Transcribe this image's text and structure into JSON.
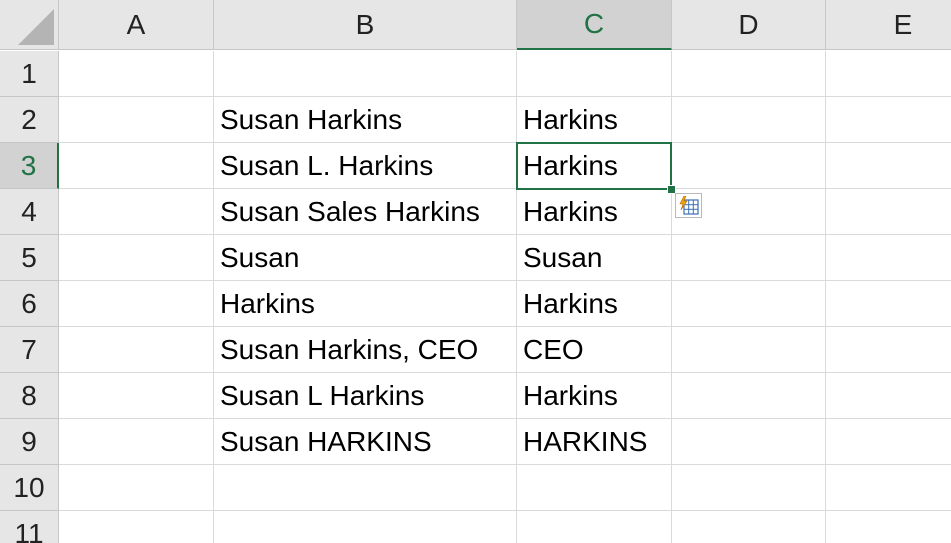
{
  "columns": [
    "A",
    "B",
    "C",
    "D",
    "E"
  ],
  "rows": [
    "1",
    "2",
    "3",
    "4",
    "5",
    "6",
    "7",
    "8",
    "9",
    "10",
    "11"
  ],
  "cells": {
    "B2": "Susan Harkins",
    "C2": "Harkins",
    "B3": "Susan L. Harkins",
    "C3": "Harkins",
    "B4": "Susan Sales Harkins",
    "C4": "Harkins",
    "B5": "Susan",
    "C5": "Susan",
    "B6": "Harkins",
    "C6": "Harkins",
    "B7": "Susan Harkins, CEO",
    "C7": "CEO",
    "B8": "Susan L Harkins",
    "C8": "Harkins",
    "B9": "Susan HARKINS",
    "C9": "HARKINS"
  },
  "active_cell": "C3",
  "accent_color": "#217346",
  "icons": {
    "flash_fill": "flash-fill-options-icon"
  }
}
